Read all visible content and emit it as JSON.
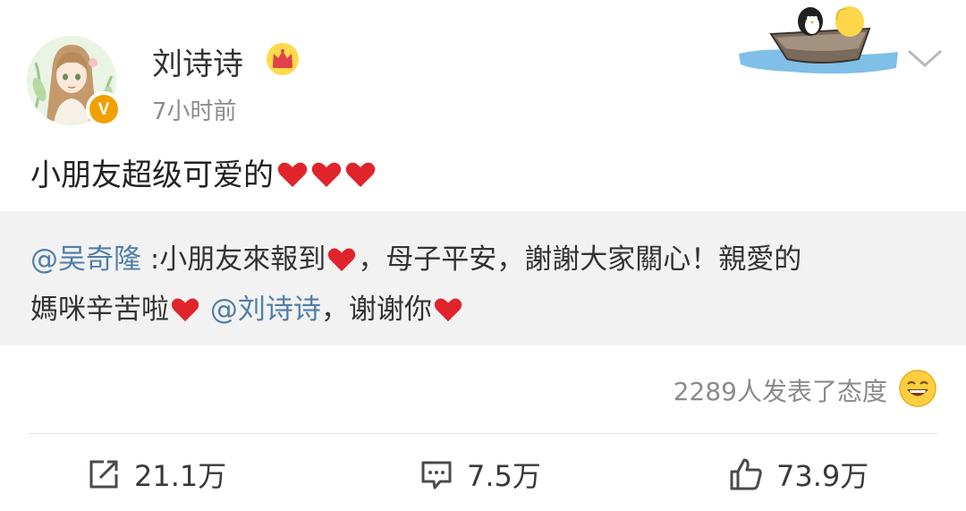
{
  "post": {
    "author": "刘诗诗",
    "time": "7小时前",
    "verified_mark": "V",
    "text": "小朋友超级可爱的",
    "heart_count": 3
  },
  "repost": {
    "author_mention": "@吴奇隆",
    "line1_part1": " :小朋友來報到",
    "line1_part2": "，母子平安，謝謝大家關心！親愛的",
    "line2_part1": "媽咪辛苦啦",
    "mention2": " @刘诗诗",
    "line2_part2": "，谢谢你"
  },
  "reactions": {
    "text": "2289人发表了态度"
  },
  "actions": {
    "repost_count": "21.1万",
    "comment_count": "7.5万",
    "like_count": "73.9万"
  },
  "icons": {
    "repost": "share-out-icon",
    "comment": "comment-icon",
    "like": "thumbs-up-icon",
    "chevron": "chevron-down-icon",
    "crown": "crown-icon",
    "laugh": "laughing-emoji-icon",
    "heart": "red-heart-icon"
  },
  "colors": {
    "mention": "#4f7ea8",
    "heart": "#e0242b",
    "verified": "#f0a100",
    "quote_bg": "#f2f2f2"
  }
}
